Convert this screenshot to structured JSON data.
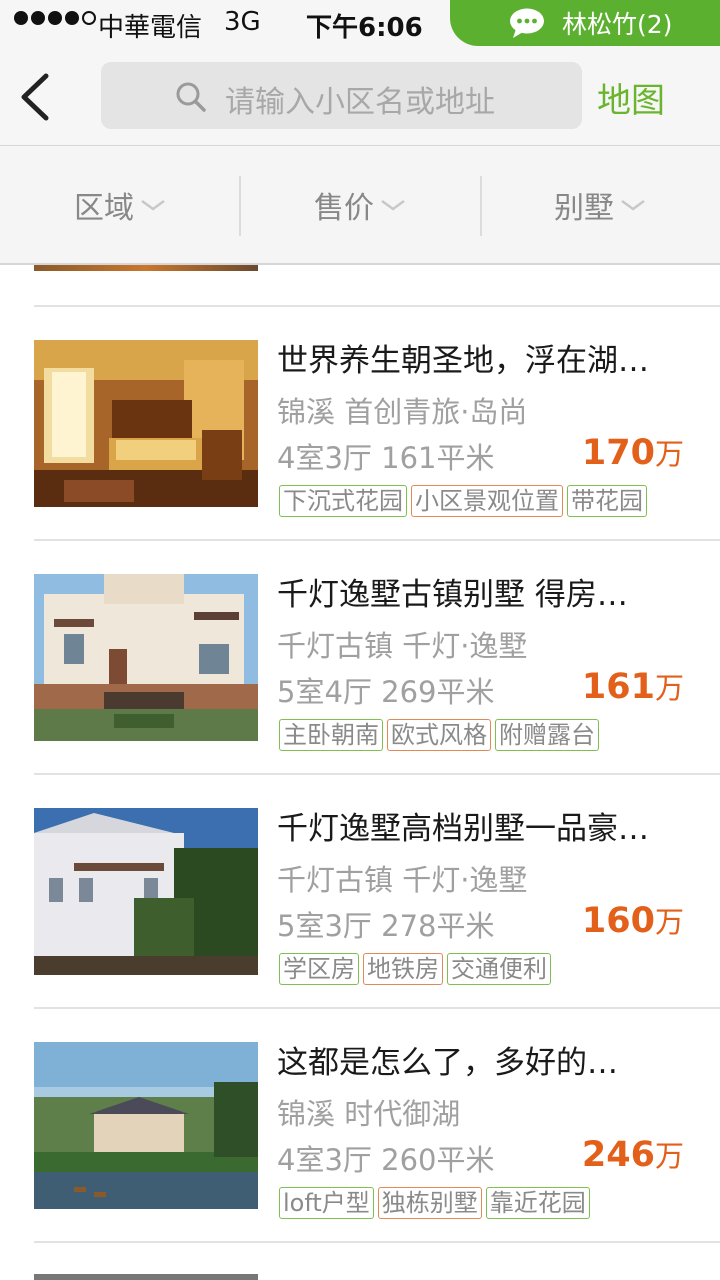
{
  "status_bar": {
    "carrier": "中華電信",
    "network": "3G",
    "time": "下午6:06",
    "chat_name": "林松竹(2)",
    "chat_icon": "chat-bubble-icon"
  },
  "header": {
    "search_placeholder": "请输入小区名或地址",
    "map_label": "地图"
  },
  "filters": [
    {
      "label": "区域"
    },
    {
      "label": "售价"
    },
    {
      "label": "别墅"
    }
  ],
  "listings": [
    {
      "title": "世界养生朝圣地，浮在湖…",
      "location": "锦溪 首创青旅·岛尚",
      "spec": "4室3厅 161平米",
      "price": "170",
      "price_unit": "万",
      "tags": [
        "下沉式花园",
        "小区景观位置",
        "带花园"
      ]
    },
    {
      "title": "千灯逸墅古镇别墅 得房…",
      "location": "千灯古镇 千灯·逸墅",
      "spec": "5室4厅 269平米",
      "price": "161",
      "price_unit": "万",
      "tags": [
        "主卧朝南",
        "欧式风格",
        "附赠露台"
      ]
    },
    {
      "title": "千灯逸墅高档别墅一品豪…",
      "location": "千灯古镇 千灯·逸墅",
      "spec": "5室3厅 278平米",
      "price": "160",
      "price_unit": "万",
      "tags": [
        "学区房",
        "地铁房",
        "交通便利"
      ]
    },
    {
      "title": " 这都是怎么了，多好的…",
      "location": "锦溪 时代御湖",
      "spec": "4室3厅 260平米",
      "price": "246",
      "price_unit": "万",
      "tags": [
        "loft户型",
        "独栋别墅",
        "靠近花园"
      ]
    }
  ],
  "colors": {
    "accent_green": "#6bb52e",
    "price_orange": "#e2601a",
    "tag_green_border": "#7fbf4f",
    "tag_orange_border": "#e08a58"
  }
}
